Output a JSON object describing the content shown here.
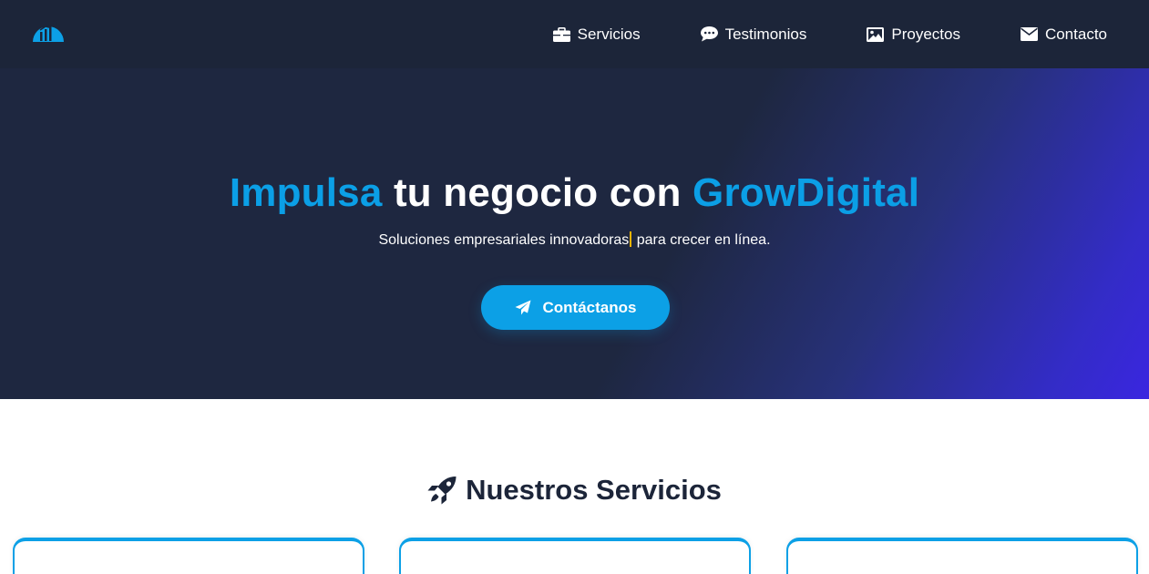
{
  "nav": {
    "logo_icon": "chart-dome-logo",
    "items": [
      {
        "label": "Servicios",
        "icon": "briefcase-icon"
      },
      {
        "label": "Testimonios",
        "icon": "comment-icon"
      },
      {
        "label": "Proyectos",
        "icon": "image-icon"
      },
      {
        "label": "Contacto",
        "icon": "envelope-icon"
      }
    ]
  },
  "hero": {
    "title_accent_1": "Impulsa",
    "title_middle": " tu negocio con ",
    "title_accent_2": "GrowDigital",
    "subtitle_before_caret": "Soluciones empresariales innovadoras",
    "subtitle_after_caret": " para crecer en línea.",
    "cta_label": "Contáctanos",
    "cta_icon": "paper-plane-icon"
  },
  "services": {
    "title": "Nuestros Servicios",
    "title_icon": "rocket-icon",
    "card_count_visible": 3
  },
  "colors": {
    "navbar_bg": "#1c2539",
    "hero_bg": "#1e2740",
    "hero_gradient_end": "#3a26e0",
    "accent": "#0ca0e6",
    "caret": "#f4b400",
    "section_title": "#1c2539"
  }
}
